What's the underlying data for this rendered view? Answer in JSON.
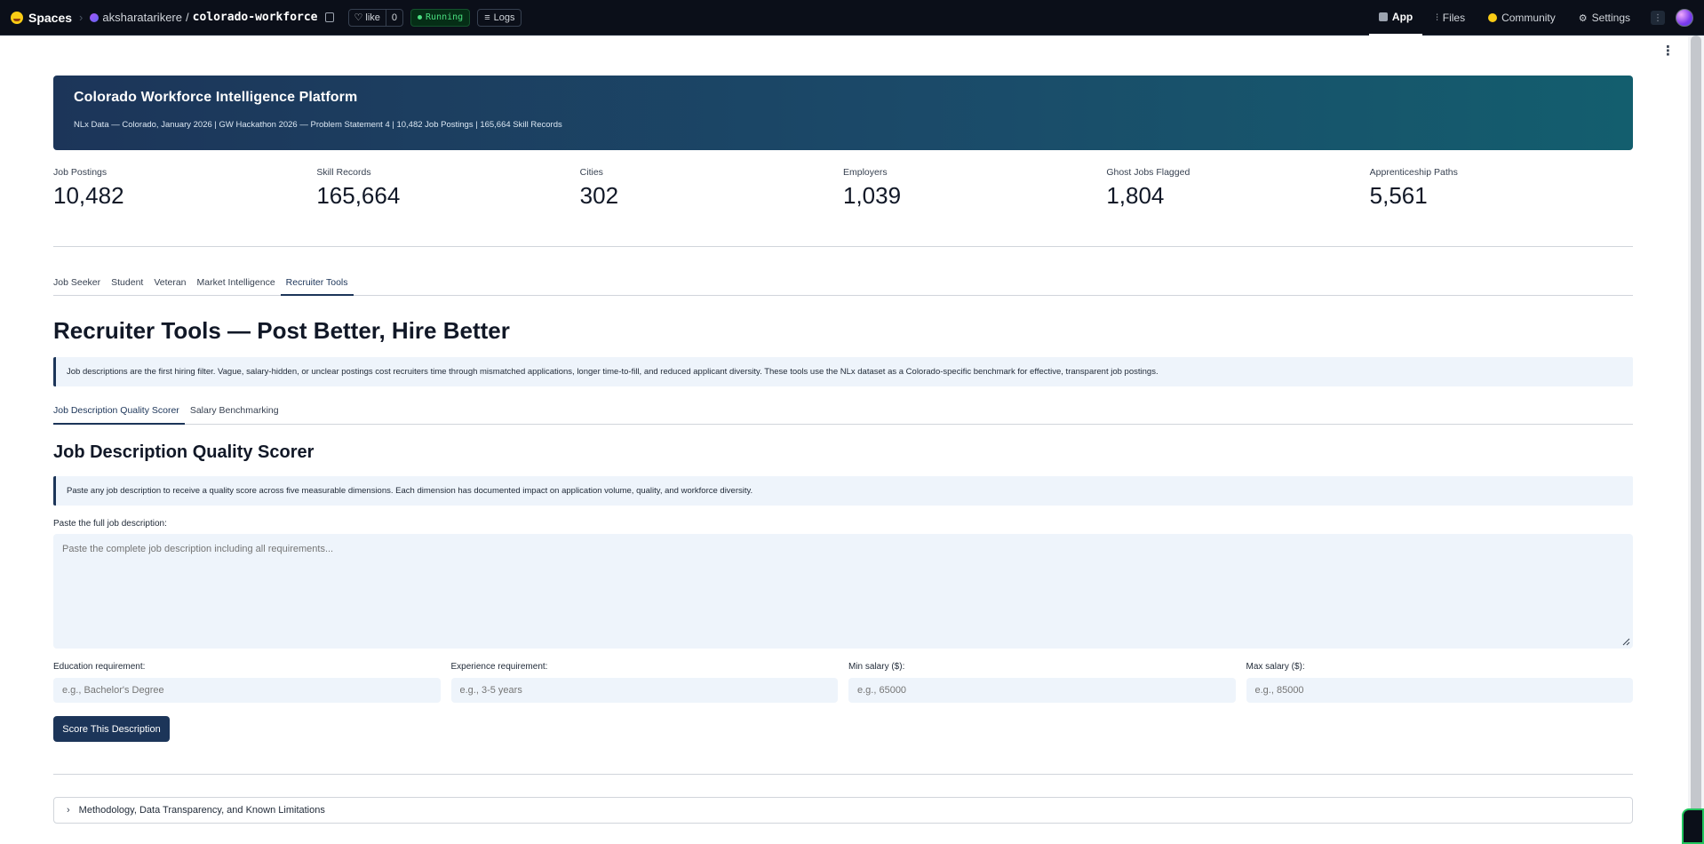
{
  "topbar": {
    "brand": "Spaces",
    "owner": "aksharatarikere",
    "slash": "/",
    "repo": "colorado-workforce",
    "like_label": "like",
    "like_count": "0",
    "status": "Running",
    "logs": "Logs",
    "nav": [
      {
        "label": "App",
        "icon": "app-icon",
        "active": true
      },
      {
        "label": "Files",
        "icon": "files-icon",
        "active": false
      },
      {
        "label": "Community",
        "icon": "community-icon",
        "active": false
      },
      {
        "label": "Settings",
        "icon": "gear-icon",
        "active": false
      }
    ]
  },
  "header": {
    "title": "Colorado Workforce Intelligence Platform",
    "subtitle": "NLx Data — Colorado, January 2026  |  GW Hackathon 2026 — Problem Statement 4  |  10,482 Job Postings  |  165,664 Skill Records"
  },
  "stats": [
    {
      "label": "Job Postings",
      "value": "10,482"
    },
    {
      "label": "Skill Records",
      "value": "165,664"
    },
    {
      "label": "Cities",
      "value": "302"
    },
    {
      "label": "Employers",
      "value": "1,039"
    },
    {
      "label": "Ghost Jobs Flagged",
      "value": "1,804"
    },
    {
      "label": "Apprenticeship Paths",
      "value": "5,561"
    }
  ],
  "tabs": [
    "Job Seeker",
    "Student",
    "Veteran",
    "Market Intelligence",
    "Recruiter Tools"
  ],
  "active_tab": "Recruiter Tools",
  "section": {
    "title": "Recruiter Tools — Post Better, Hire Better",
    "info": "Job descriptions are the first hiring filter. Vague, salary-hidden, or unclear postings cost recruiters time through mismatched applications, longer time-to-fill, and reduced applicant diversity. These tools use the NLx dataset as a Colorado-specific benchmark for effective, transparent job postings."
  },
  "subtabs": [
    "Job Description Quality Scorer",
    "Salary Benchmarking"
  ],
  "scorer": {
    "title": "Job Description Quality Scorer",
    "info": "Paste any job description to receive a quality score across five measurable dimensions. Each dimension has documented impact on application volume, quality, and workforce diversity.",
    "description_label": "Paste the full job description:",
    "description_placeholder": "Paste the complete job description including all requirements...",
    "fields": [
      {
        "label": "Education requirement:",
        "placeholder": "e.g., Bachelor's Degree"
      },
      {
        "label": "Experience requirement:",
        "placeholder": "e.g., 3-5 years"
      },
      {
        "label": "Min salary ($):",
        "placeholder": "e.g., 65000"
      },
      {
        "label": "Max salary ($):",
        "placeholder": "e.g., 85000"
      }
    ],
    "button": "Score This Description"
  },
  "accordion": {
    "label": "Methodology, Data Transparency, and Known Limitations"
  },
  "colors": {
    "accent": "#1c3559",
    "banner_start": "#1c3559",
    "banner_end": "#135e6e",
    "running": "#4ade80"
  }
}
